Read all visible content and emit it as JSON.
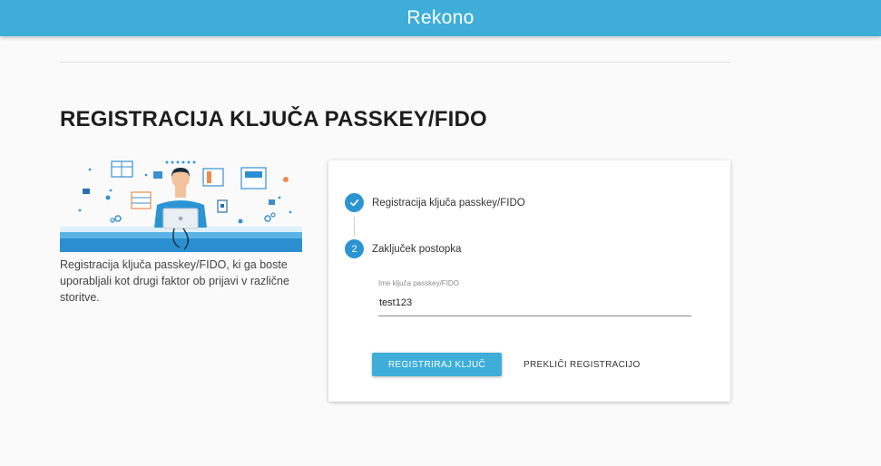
{
  "header": {
    "brand": "Rekono"
  },
  "page": {
    "title": "REGISTRACIJA KLJUČA PASSKEY/FIDO",
    "intro": "Registracija ključa passkey/FIDO, ki ga boste uporabljali kot drugi faktor ob prijavi v različne storitve."
  },
  "steps": [
    {
      "number": "✓",
      "label": "Registracija ključa passkey/FIDO",
      "state": "completed"
    },
    {
      "number": "2",
      "label": "Zaključek postopka",
      "state": "active"
    }
  ],
  "form": {
    "key_name_label": "Ime ključa passkey/FIDO",
    "key_name_value": "test123"
  },
  "actions": {
    "register_label": "REGISTRIRAJ KLJUČ",
    "cancel_label": "PREKLIČI REGISTRACIJO"
  },
  "colors": {
    "header": "#3eaed9",
    "step_circle": "#2b95d3",
    "primary_button": "#3eaed9"
  }
}
